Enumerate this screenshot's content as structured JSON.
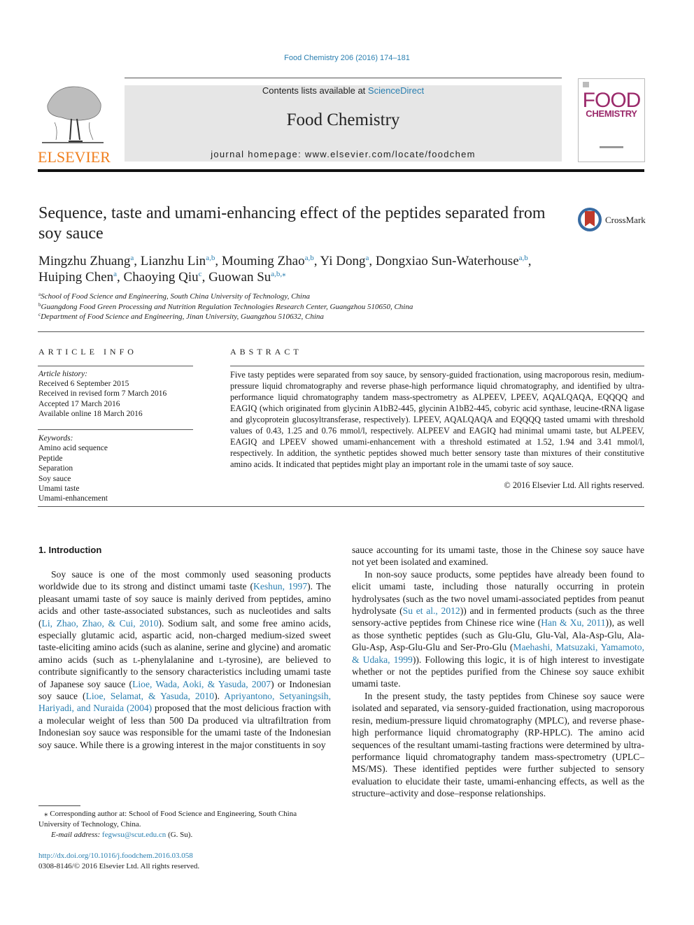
{
  "header": {
    "citation": "Food Chemistry 206 (2016) 174–181",
    "publisher_logo_text": "ELSEVIER",
    "contents_prefix": "Contents lists available at ",
    "contents_link": "ScienceDirect",
    "journal_title": "Food Chemistry",
    "homepage": "journal homepage: www.elsevier.com/locate/foodchem",
    "cover_line1": "FOOD",
    "cover_line2": "CHEMISTRY",
    "colors": {
      "link": "#2a7fb0",
      "elsevier_orange": "#f07f1e",
      "cover_magenta": "#9b2a6b"
    }
  },
  "article": {
    "title": "Sequence, taste and umami-enhancing effect of the peptides separated from soy sauce",
    "crossmark_label": "CrossMark",
    "authors": [
      {
        "name": "Mingzhu Zhuang",
        "sup": "a"
      },
      {
        "name": "Lianzhu Lin",
        "sup": "a,b"
      },
      {
        "name": "Mouming Zhao",
        "sup": "a,b"
      },
      {
        "name": "Yi Dong",
        "sup": "a"
      },
      {
        "name": "Dongxiao Sun-Waterhouse",
        "sup": "a,b"
      },
      {
        "name": "Huiping Chen",
        "sup": "a"
      },
      {
        "name": "Chaoying Qiu",
        "sup": "c"
      },
      {
        "name": "Guowan Su",
        "sup": "a,b,⁎"
      }
    ],
    "affiliations": [
      {
        "key": "a",
        "text": "School of Food Science and Engineering, South China University of Technology, China"
      },
      {
        "key": "b",
        "text": "Guangdong Food Green Processing and Nutrition Regulation Technologies Research Center, Guangzhou 510650, China"
      },
      {
        "key": "c",
        "text": "Department of Food Science and Engineering, Jinan University, Guangzhou 510632, China"
      }
    ]
  },
  "article_info": {
    "heading": "ARTICLE INFO",
    "history_label": "Article history:",
    "history": [
      "Received 6 September 2015",
      "Received in revised form 7 March 2016",
      "Accepted 17 March 2016",
      "Available online 18 March 2016"
    ],
    "keywords_label": "Keywords:",
    "keywords": [
      "Amino acid sequence",
      "Peptide",
      "Separation",
      "Soy sauce",
      "Umami taste",
      "Umami-enhancement"
    ]
  },
  "abstract": {
    "heading": "ABSTRACT",
    "text": "Five tasty peptides were separated from soy sauce, by sensory-guided fractionation, using macroporous resin, medium-pressure liquid chromatography and reverse phase-high performance liquid chromatography, and identified by ultra-performance liquid chromatography tandem mass-spectrometry as ALPEEV, LPEEV, AQALQAQA, EQQQQ and EAGIQ (which originated from glycinin A1bB2-445, glycinin A1bB2-445, cobyric acid synthase, leucine-tRNA ligase and glycoprotein glucosyltransferase, respectively). LPEEV, AQALQAQA and EQQQQ tasted umami with threshold values of 0.43, 1.25 and 0.76 mmol/l, respectively. ALPEEV and EAGIQ had minimal umami taste, but ALPEEV, EAGIQ and LPEEV showed umami-enhancement with a threshold estimated at 1.52, 1.94 and 3.41 mmol/l, respectively. In addition, the synthetic peptides showed much better sensory taste than mixtures of their constitutive amino acids. It indicated that peptides might play an important role in the umami taste of soy sauce.",
    "copyright": "© 2016 Elsevier Ltd. All rights reserved."
  },
  "intro": {
    "heading": "1. Introduction",
    "p1": [
      {
        "t": "Soy sauce is one of the most commonly used seasoning products worldwide due to its strong and distinct umami taste ("
      },
      {
        "link": "Keshun, 1997"
      },
      {
        "t": "). The pleasant umami taste of soy sauce is mainly derived from peptides, amino acids and other taste-associated substances, such as nucleotides and salts ("
      },
      {
        "link": "Li, Zhao, Zhao, & Cui, 2010"
      },
      {
        "t": "). Sodium salt, and some free amino acids, especially glutamic acid, aspartic acid, non-charged medium-sized sweet taste-eliciting amino acids (such as alanine, serine and glycine) and aromatic amino acids (such as "
      },
      {
        "sc": "l"
      },
      {
        "t": "-phenylalanine and "
      },
      {
        "sc": "l"
      },
      {
        "t": "-tyrosine), are believed to contribute significantly to the sensory characteristics including umami taste of Japanese soy sauce ("
      },
      {
        "link": "Lioe, Wada, Aoki, & Yasuda, 2007"
      },
      {
        "t": ") or Indonesian soy sauce ("
      },
      {
        "link": "Lioe, Selamat, & Yasuda, 2010"
      },
      {
        "t": "). "
      },
      {
        "link": "Apriyantono, Setyaningsih, Hariyadi, and Nuraida (2004)"
      },
      {
        "t": " proposed that the most delicious fraction with a molecular weight of less than 500 Da produced via ultrafiltration from Indonesian soy sauce was responsible for the umami taste of the Indonesian soy sauce. While there is a growing interest in the major constituents in soy sauce accounting for its umami taste, those in the Chinese soy sauce have not yet been isolated and examined."
      }
    ],
    "p2": [
      {
        "t": "In non-soy sauce products, some peptides have already been found to elicit umami taste, including those naturally occurring in protein hydrolysates (such as the two novel umami-associated peptides from peanut hydrolysate ("
      },
      {
        "link": "Su et al., 2012"
      },
      {
        "t": ")) and in fermented products (such as the three sensory-active peptides from Chinese rice wine ("
      },
      {
        "link": "Han & Xu, 2011"
      },
      {
        "t": ")), as well as those synthetic peptides (such as Glu-Glu, Glu-Val, Ala-Asp-Glu, Ala-Glu-Asp, Asp-Glu-Glu and Ser-Pro-Glu ("
      },
      {
        "link": "Maehashi, Matsuzaki, Yamamoto, & Udaka, 1999"
      },
      {
        "t": ")). Following this logic, it is of high interest to investigate whether or not the peptides purified from the Chinese soy sauce exhibit umami taste."
      }
    ],
    "p3": "In the present study, the tasty peptides from Chinese soy sauce were isolated and separated, via sensory-guided fractionation, using macroporous resin, medium-pressure liquid chromatography (MPLC), and reverse phase-high performance liquid chromatography (RP-HPLC). The amino acid sequences of the resultant umami-tasting fractions were determined by ultra-performance liquid chromatography tandem mass-spectrometry (UPLC–MS/MS). These identified peptides were further subjected to sensory evaluation to elucidate their taste, umami-enhancing effects, as well as the structure–activity and dose–response relationships."
  },
  "footnote": {
    "corresponding": "⁎ Corresponding author at: School of Food Science and Engineering, South China University of Technology, China.",
    "email_label": "E-mail address: ",
    "email": "fegwsu@scut.edu.cn",
    "email_suffix": " (G. Su).",
    "doi": "http://dx.doi.org/10.1016/j.foodchem.2016.03.058",
    "issn": "0308-8146/© 2016 Elsevier Ltd. All rights reserved."
  }
}
